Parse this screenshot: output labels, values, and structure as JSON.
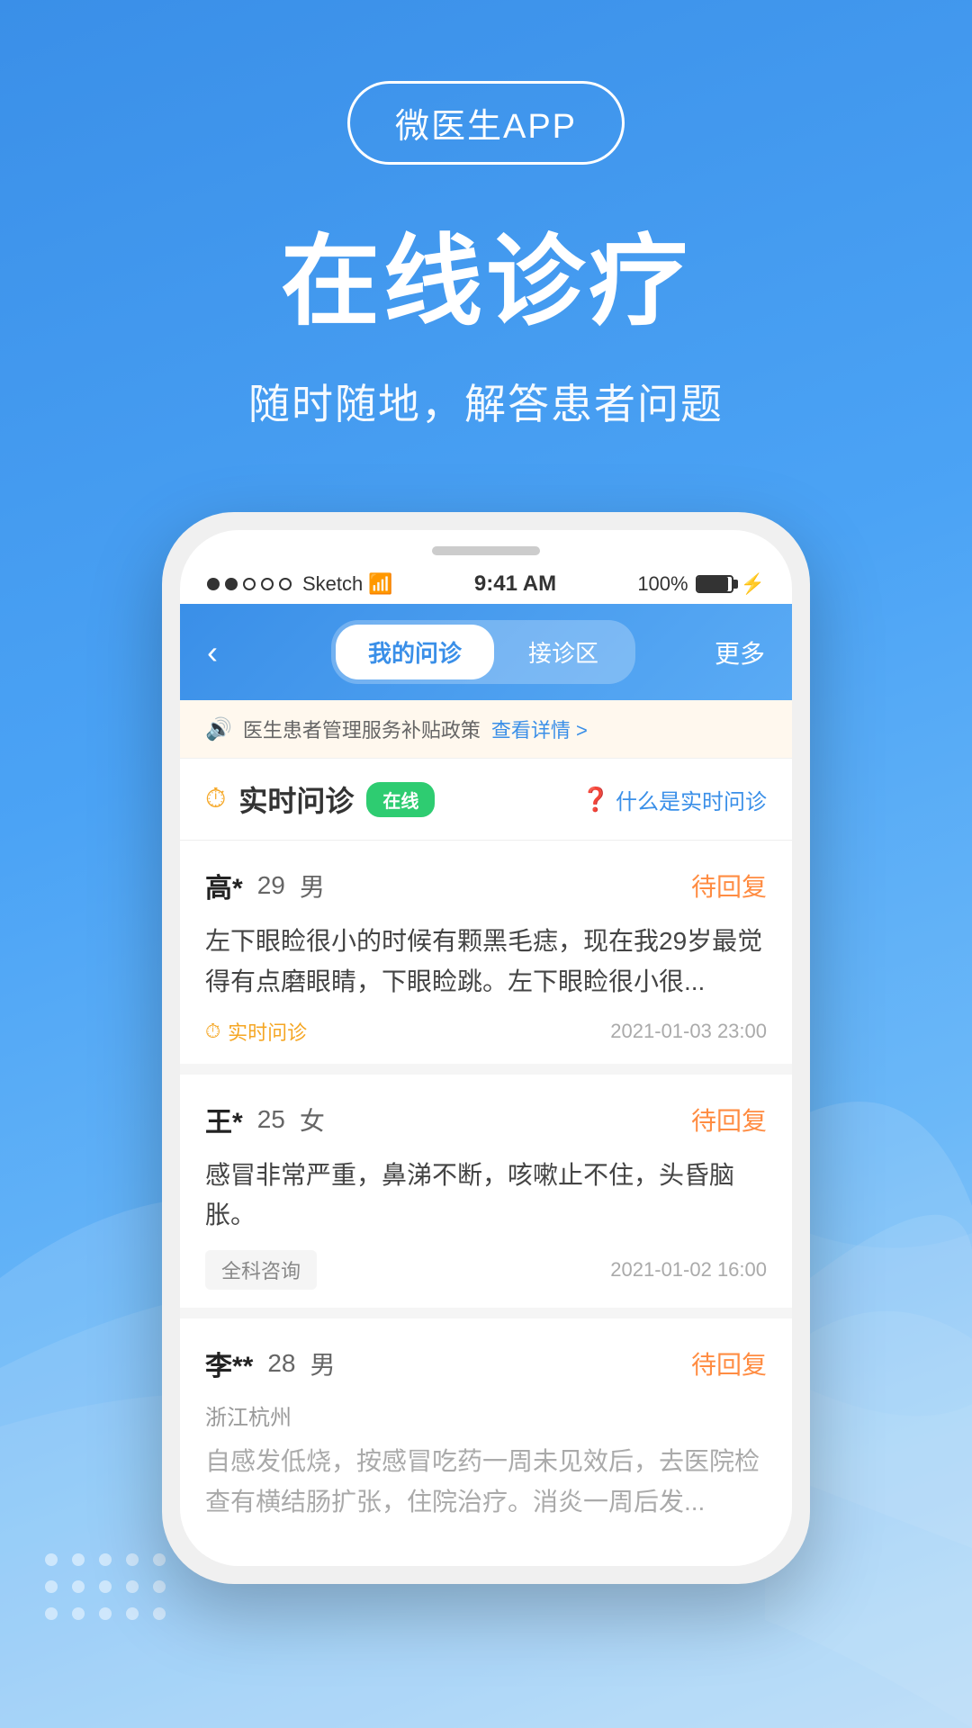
{
  "app": {
    "badge_text": "微医生APP",
    "main_title": "在线诊疗",
    "sub_title": "随时随地，解答患者问题"
  },
  "status_bar": {
    "dots_filled": 2,
    "dots_empty": 3,
    "carrier": "Sketch",
    "time": "9:41 AM",
    "battery": "100%"
  },
  "header": {
    "back_label": "‹",
    "tab1_label": "我的问诊",
    "tab2_label": "接诊区",
    "more_label": "更多"
  },
  "notice": {
    "text": "医生患者管理服务补贴政策",
    "link_text": "查看详情 >"
  },
  "section": {
    "title": "实时问诊",
    "online_badge": "在线",
    "help_text": "什么是实时问诊"
  },
  "cases": [
    {
      "name": "高*",
      "age": "29",
      "gender": "男",
      "location": "",
      "status": "待回复",
      "description": "左下眼睑很小的时候有颗黑毛痣，现在我29岁最觉得有点磨眼睛，下眼睑跳。左下眼睑很小很...",
      "tag": "实时问诊",
      "tag_type": "realtime",
      "time": "2021-01-03 23:00",
      "description_gray": false
    },
    {
      "name": "王*",
      "age": "25",
      "gender": "女",
      "location": "",
      "status": "待回复",
      "description": "感冒非常严重，鼻涕不断，咳嗽止不住，头昏脑胀。",
      "tag": "全科咨询",
      "tag_type": "general",
      "time": "2021-01-02 16:00",
      "description_gray": false
    },
    {
      "name": "李**",
      "age": "28",
      "gender": "男",
      "location": "浙江杭州",
      "status": "待回复",
      "description": "自感发低烧，按感冒吃药一周未见效后，去医院检查有横结肠扩张，住院治疗。消炎一周后发...",
      "tag": "",
      "tag_type": "none",
      "time": "",
      "description_gray": true
    }
  ]
}
